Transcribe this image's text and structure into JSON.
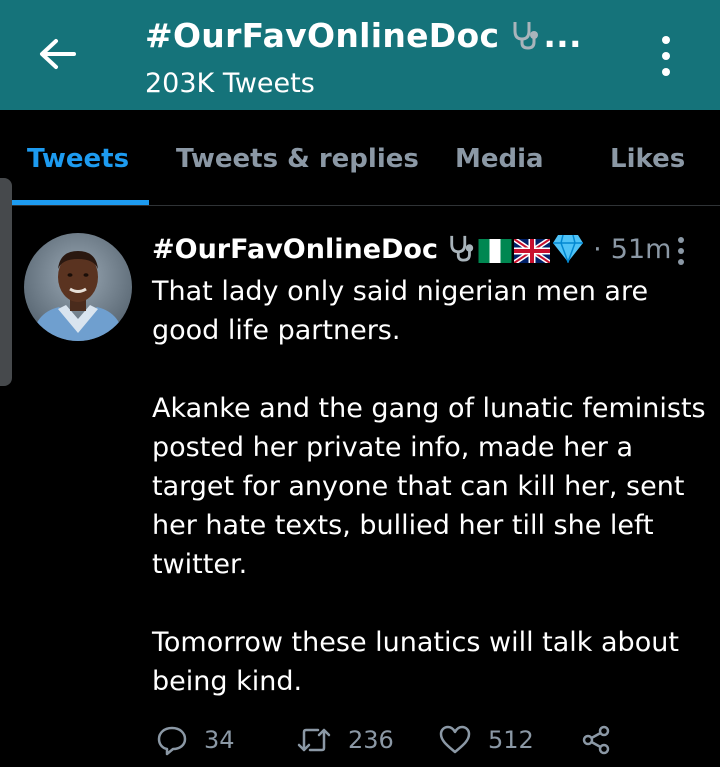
{
  "header": {
    "title": "#OurFavOnlineDoc",
    "title_ellipsis": "...",
    "subtitle": "203K Tweets",
    "background": "#15737a",
    "icons": [
      "back-arrow-icon",
      "stethoscope-icon",
      "more-vertical-icon"
    ]
  },
  "tabs": [
    {
      "label": "Tweets",
      "active": true
    },
    {
      "label": "Tweets & replies",
      "active": false
    },
    {
      "label": "Media",
      "active": false
    },
    {
      "label": "Likes",
      "active": false
    }
  ],
  "tweet": {
    "author": "#OurFavOnlineDoc",
    "emoji_icons": [
      "stethoscope-icon",
      "nigeria-flag-icon",
      "uk-flag-icon",
      "gem-icon"
    ],
    "separator": "·",
    "time": "51m",
    "text": "That lady only said nigerian men are\ngood life partners.\n\nAkanke and the gang of lunatic feminists\nposted her private info, made her a\ntarget for anyone that can kill her, sent\nher hate texts, bullied her till she left\ntwitter.\n\nTomorrow these lunatics will talk about\nbeing kind.",
    "actions": {
      "reply_count": "34",
      "retweet_count": "236",
      "like_count": "512"
    }
  },
  "colors": {
    "accent": "#1d9bf0",
    "muted": "#8b98a5",
    "background": "#000000"
  }
}
